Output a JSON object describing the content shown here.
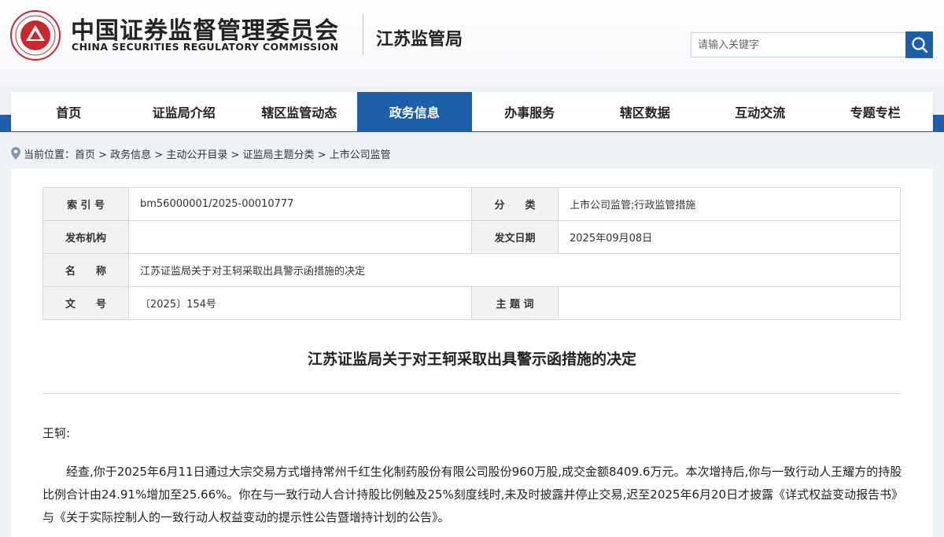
{
  "header": {
    "org_name_cn": "中国证券监督管理委员会",
    "org_name_en": "CHINA SECURITIES REGULATORY COMMISSION",
    "bureau_name": "江苏监管局",
    "emblem_icon": "csrc-emblem-icon",
    "brand_color": "#1d5fa8",
    "emblem_color": "#c9282d"
  },
  "search": {
    "placeholder": "请输入关键字",
    "icon": "search-icon"
  },
  "nav": {
    "items": [
      {
        "label": "首页"
      },
      {
        "label": "证监局介绍"
      },
      {
        "label": "辖区监管动态"
      },
      {
        "label": "政务信息"
      },
      {
        "label": "办事服务"
      },
      {
        "label": "辖区数据"
      },
      {
        "label": "互动交流"
      },
      {
        "label": "专题专栏"
      }
    ],
    "active_index": 3
  },
  "breadcrumb": {
    "text": "当前位置：首页 > 政务信息 > 主动公开目录 > 证监局主题分类 > 上市公司监管"
  },
  "meta": {
    "index_label": "索 引 号",
    "index_value": "bm56000001/2025-00010777",
    "category_label": "分　　类",
    "category_value": "上市公司监管;行政监管措施",
    "issuer_label": "发布机构",
    "issuer_value": "",
    "date_label": "发文日期",
    "date_value": "2025年09月08日",
    "name_label": "名　　称",
    "name_value": "江苏证监局关于对王轲采取出具警示函措施的决定",
    "docno_label": "文　　号",
    "docno_value": "〔2025〕154号",
    "subject_label": "主 题 词",
    "subject_value": ""
  },
  "document": {
    "title": "江苏证监局关于对王轲采取出具警示函措施的决定",
    "addressee": "王轲:",
    "paragraph": "经查,你于2025年6月11日通过大宗交易方式增持常州千红生化制药股份有限公司股份960万股,成交金额8409.6万元。本次增持后,你与一致行动人王耀方的持股比例合计由24.91%增加至25.66%。你在与一致行动人合计持股比例触及25%刻度线时,未及时披露并停止交易,迟至2025年6月20日才披露《详式权益变动报告书》与《关于实际控制人的一致行动人权益变动的提示性公告暨增持计划的公告》。"
  }
}
